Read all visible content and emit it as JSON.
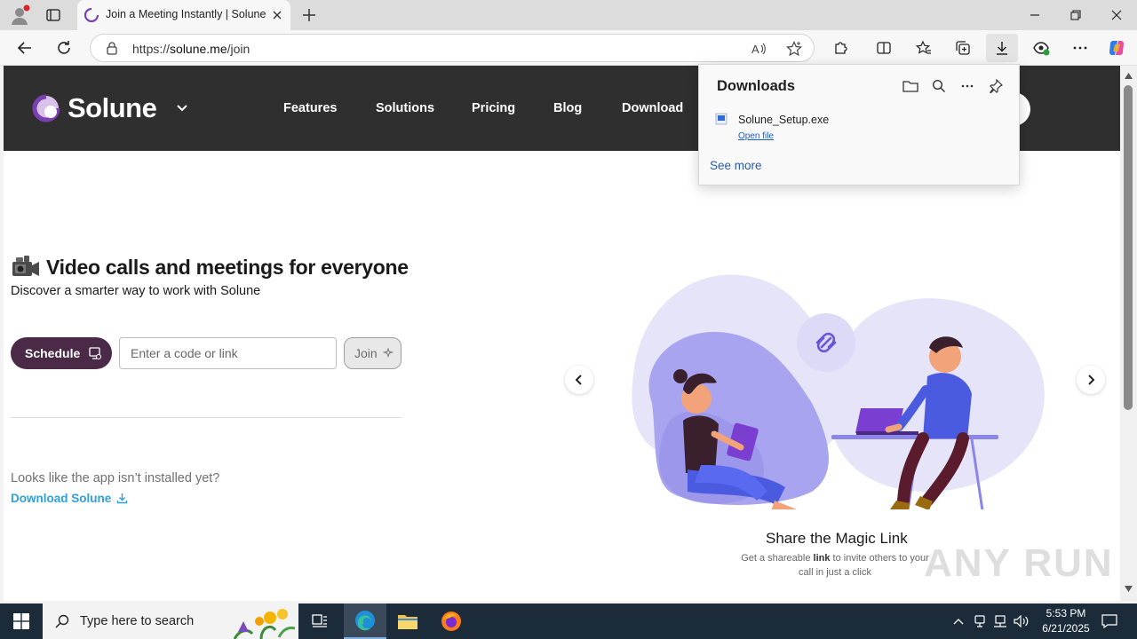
{
  "browser": {
    "tab_title": "Join a Meeting Instantly | Solune",
    "url_scheme": "https://",
    "url_host": "solune.me",
    "url_path": "/join"
  },
  "site": {
    "brand": "Solune",
    "nav": [
      "Features",
      "Solutions",
      "Pricing",
      "Blog",
      "Download"
    ],
    "hero_title": "Video calls and meetings for everyone",
    "hero_subtitle": "Discover a smarter way to work with Solune",
    "schedule_label": "Schedule",
    "code_placeholder": "Enter a code or link",
    "join_label": "Join",
    "not_installed": "Looks like the app isn’t installed yet?",
    "download_link": "Download Solune",
    "slide_title": "Share the Magic Link",
    "slide_desc_pre": "Get a shareable ",
    "slide_desc_bold": "link",
    "slide_desc_post": " to invite others to your call in just a click"
  },
  "downloads": {
    "title": "Downloads",
    "file_name": "Solune_Setup.exe",
    "open_file": "Open file",
    "see_more": "See more"
  },
  "taskbar": {
    "search_placeholder": "Type here to search",
    "time": "5:53 PM",
    "date": "6/21/2025"
  },
  "watermark": "ANY RUN",
  "colors": {
    "header_bg": "#2f2f2f",
    "schedule_bg": "#4a2a47",
    "link_blue": "#2ea0db",
    "illustration_purple": "#a8a4f0"
  }
}
